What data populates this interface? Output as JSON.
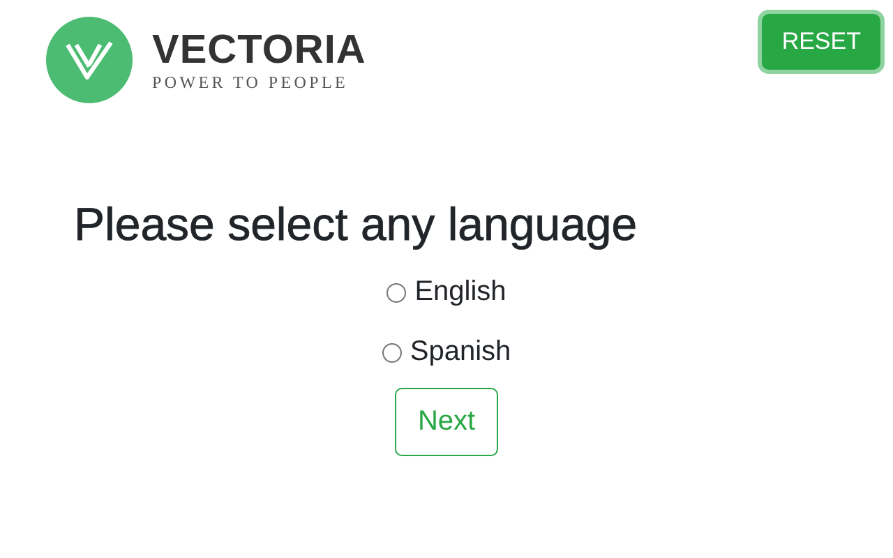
{
  "logo": {
    "name": "VECTORIA",
    "tagline": "POWER TO PEOPLE"
  },
  "reset_button": "RESET",
  "heading": "Please select any language",
  "languages": [
    {
      "label": "English",
      "selected": false
    },
    {
      "label": "Spanish",
      "selected": false
    }
  ],
  "next_button": "Next"
}
